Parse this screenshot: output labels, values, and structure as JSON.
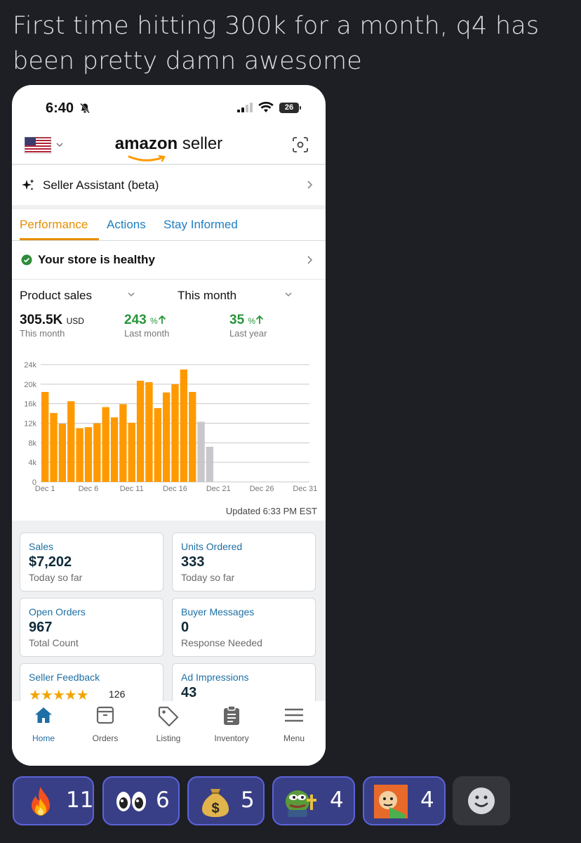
{
  "post": {
    "title": "First time hitting 300k for a month, q4 has been pretty damn awesome"
  },
  "status_bar": {
    "time": "6:40",
    "battery": "26"
  },
  "header": {
    "brand_bold": "amazon",
    "brand_light": " seller"
  },
  "assistant": {
    "label": "Seller Assistant (beta)"
  },
  "tabs": [
    {
      "label": "Performance",
      "active": true
    },
    {
      "label": "Actions",
      "active": false
    },
    {
      "label": "Stay Informed",
      "active": false
    }
  ],
  "health": {
    "label": "Your store is healthy"
  },
  "selectors": {
    "metric": "Product sales",
    "period": "This month"
  },
  "metrics": {
    "total_value": "305.5K",
    "total_unit": "USD",
    "total_label": "This month",
    "mom_value": "243",
    "mom_unit": "%",
    "mom_label": "Last month",
    "yoy_value": "35",
    "yoy_unit": "%",
    "yoy_label": "Last year"
  },
  "chart_data": {
    "type": "bar",
    "categories": [
      "Dec 1",
      "Dec 2",
      "Dec 3",
      "Dec 4",
      "Dec 5",
      "Dec 6",
      "Dec 7",
      "Dec 8",
      "Dec 9",
      "Dec 10",
      "Dec 11",
      "Dec 12",
      "Dec 13",
      "Dec 14",
      "Dec 15",
      "Dec 16",
      "Dec 17",
      "Dec 18",
      "Dec 19",
      "Dec 20"
    ],
    "values": [
      18400,
      14100,
      11900,
      16500,
      11000,
      11200,
      12000,
      15300,
      13200,
      15900,
      12100,
      20700,
      20400,
      15100,
      18300,
      20000,
      23000,
      18400,
      12300,
      7200
    ],
    "projected_from_index": 18,
    "colors": {
      "actual": "#ff9900",
      "projected": "#c8c8cc"
    },
    "yticks": [
      0,
      4000,
      8000,
      12000,
      16000,
      20000,
      24000
    ],
    "ytick_labels": [
      "0",
      "4k",
      "8k",
      "12k",
      "16k",
      "20k",
      "24k"
    ],
    "xtick_labels": [
      "Dec 1",
      "Dec 6",
      "Dec 11",
      "Dec 16",
      "Dec 21",
      "Dec 26",
      "Dec 31"
    ],
    "ylim": [
      0,
      24000
    ],
    "grid": true
  },
  "updated": "Updated 6:33 PM EST",
  "cards": {
    "sales": {
      "title": "Sales",
      "value": "$7,202",
      "sub": "Today so far"
    },
    "units": {
      "title": "Units Ordered",
      "value": "333",
      "sub": "Today so far"
    },
    "orders": {
      "title": "Open Orders",
      "value": "967",
      "sub": "Total Count"
    },
    "messages": {
      "title": "Buyer Messages",
      "value": "0",
      "sub": "Response Needed"
    },
    "feedback": {
      "title": "Seller Feedback",
      "stars": "★★★★★",
      "count": "126"
    },
    "ads": {
      "title": "Ad Impressions",
      "value": "43"
    }
  },
  "nav": [
    {
      "label": "Home",
      "icon": "home-icon",
      "active": true
    },
    {
      "label": "Orders",
      "icon": "orders-icon"
    },
    {
      "label": "Listing",
      "icon": "tag-icon"
    },
    {
      "label": "Inventory",
      "icon": "clipboard-icon"
    },
    {
      "label": "Menu",
      "icon": "hamburger-icon"
    }
  ],
  "reactions": [
    {
      "emoji": "fire-icon",
      "count": "11"
    },
    {
      "emoji": "eyes-icon",
      "count": "6"
    },
    {
      "emoji": "money-bag-icon",
      "count": "5"
    },
    {
      "emoji": "pepe-praying-icon",
      "count": "4"
    },
    {
      "emoji": "cartoon-face-icon",
      "count": "4"
    }
  ]
}
